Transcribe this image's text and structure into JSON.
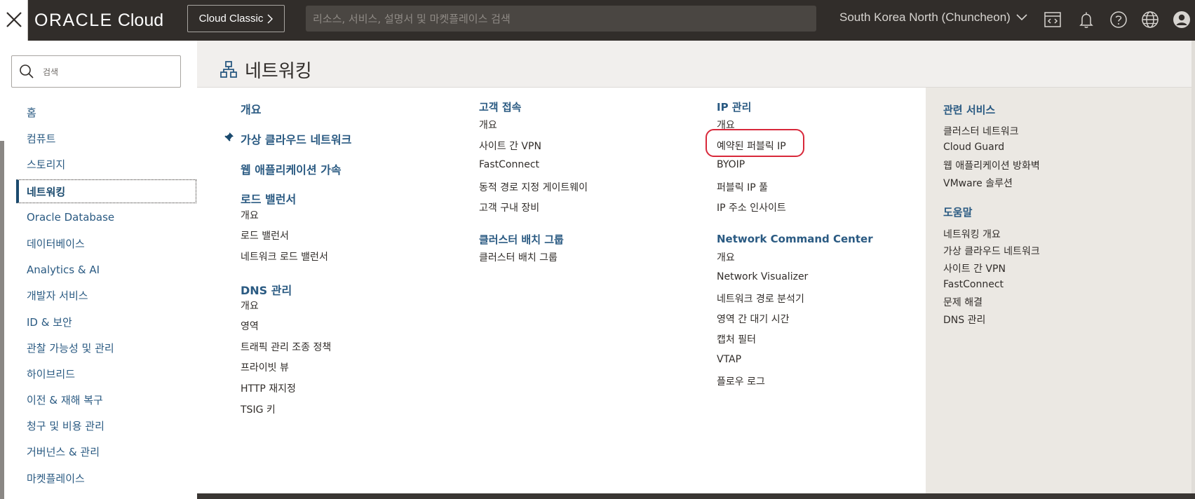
{
  "topbar": {
    "logo_brand": "ORACLE",
    "logo_product": "Cloud",
    "classic_button": "Cloud Classic",
    "search_placeholder": "리소스, 서비스, 설명서 및 마켓플레이스 검색",
    "region": "South Korea North (Chuncheon)"
  },
  "sidebar": {
    "search_placeholder": "검색",
    "items": [
      {
        "label": "홈"
      },
      {
        "label": "컴퓨트"
      },
      {
        "label": "스토리지"
      },
      {
        "label": "네트워킹",
        "active": true
      },
      {
        "label": "Oracle Database"
      },
      {
        "label": "데이터베이스"
      },
      {
        "label": "Analytics & AI"
      },
      {
        "label": "개발자 서비스"
      },
      {
        "label": "ID & 보안"
      },
      {
        "label": "관찰 가능성 및 관리"
      },
      {
        "label": "하이브리드"
      },
      {
        "label": "이전 & 재해 복구"
      },
      {
        "label": "청구 및 비용 관리"
      },
      {
        "label": "거버넌스 & 관리"
      },
      {
        "label": "마켓플레이스"
      }
    ]
  },
  "main": {
    "title": "네트워킹",
    "col1": {
      "overview": "개요",
      "vcn": "가상 클라우드 네트워크",
      "waa": "웹 애플리케이션 가속",
      "lb_head": "로드 밸런서",
      "lb_items": [
        "개요",
        "로드 밸런서",
        "네트워크 로드 밸런서"
      ],
      "dns_head": "DNS 관리",
      "dns_items": [
        "개요",
        "영역",
        "트래픽 관리 조종 정책",
        "프라이빗 뷰",
        "HTTP 재지정",
        "TSIG 키"
      ]
    },
    "col2": {
      "cc_head": "고객 접속",
      "cc_items": [
        "개요",
        "사이트 간 VPN",
        "FastConnect",
        "동적 경로 지정 게이트웨이",
        "고객 구내 장비"
      ],
      "cpg_head": "클러스터 배치 그룹",
      "cpg_items": [
        "클러스터 배치 그룹"
      ]
    },
    "col3": {
      "ip_head": "IP 관리",
      "ip_items": [
        "개요",
        "예약된 퍼블릭 IP",
        "BYOIP",
        "퍼블릭 IP 풀",
        "IP 주소 인사이트"
      ],
      "ncc_head": "Network Command Center",
      "ncc_items": [
        "개요",
        "Network Visualizer",
        "네트워크 경로 분석기",
        "영역 간 대기 시간",
        "캡처 필터",
        "VTAP",
        "플로우 로그"
      ]
    },
    "related": {
      "head": "관련 서비스",
      "items": [
        "클러스터 네트워크",
        "Cloud Guard",
        "웹 애플리케이션 방화벽",
        "VMware 솔루션"
      ],
      "help_head": "도움말",
      "help_items": [
        "네트워킹 개요",
        "가상 클라우드 네트워크",
        "사이트 간 VPN",
        "FastConnect",
        "문제 해결",
        "DNS 관리"
      ]
    }
  },
  "colors": {
    "topbar": "#312d2a",
    "link_heading": "#2a5a82",
    "highlight": "#d8283a",
    "related_panel": "#ebe8e3"
  }
}
